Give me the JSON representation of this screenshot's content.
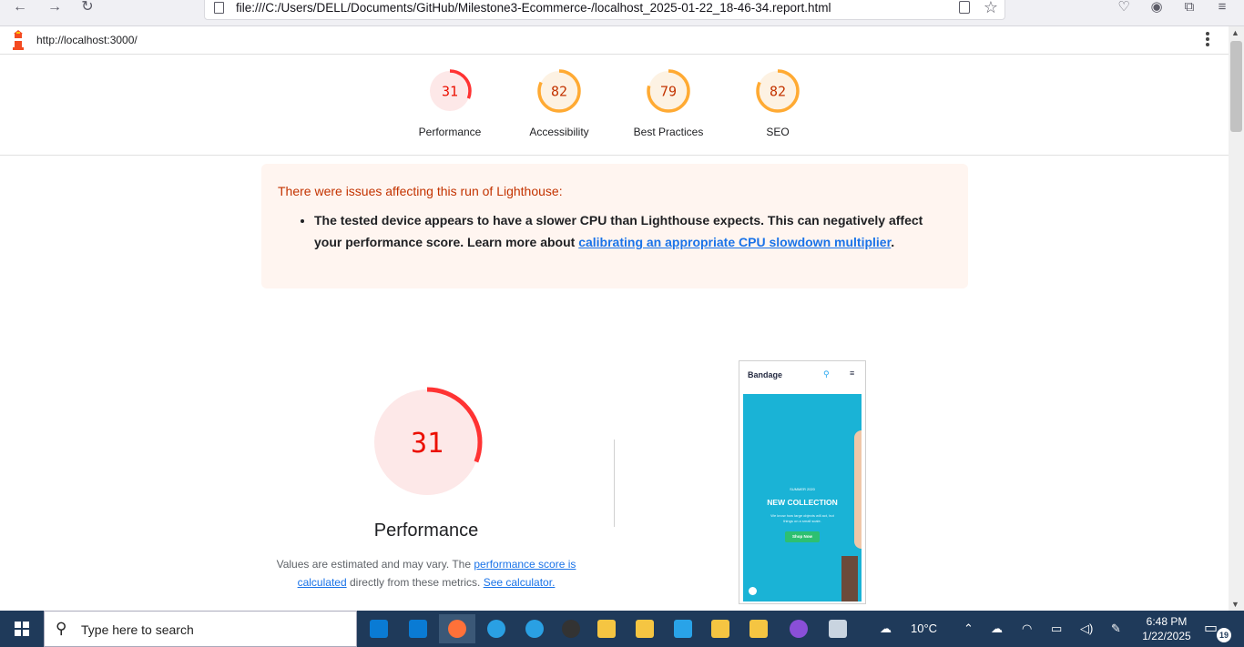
{
  "browser": {
    "url": "file:///C:/Users/DELL/Documents/GitHub/Milestone3-Ecommerce-/localhost_2025-01-22_18-46-34.report.html"
  },
  "lighthouse": {
    "tested_url": "http://localhost:3000/",
    "categories": [
      {
        "score": "31",
        "label": "Performance",
        "value": 31,
        "color": "#ff3333"
      },
      {
        "score": "82",
        "label": "Accessibility",
        "value": 82,
        "color": "#ffaa33"
      },
      {
        "score": "79",
        "label": "Best Practices",
        "value": 79,
        "color": "#ffaa33"
      },
      {
        "score": "82",
        "label": "SEO",
        "value": 82,
        "color": "#ffaa33"
      }
    ],
    "warning": {
      "title": "There were issues affecting this run of Lighthouse:",
      "item_text": "The tested device appears to have a slower CPU than Lighthouse expects. This can negatively affect your performance score. Learn more about ",
      "item_link": "calibrating an appropriate CPU slowdown multiplier",
      "item_end": "."
    },
    "performance": {
      "score": "31",
      "value": 31,
      "title": "Performance",
      "desc_pre": "Values are estimated and may vary. The ",
      "desc_link1": "performance score is calculated",
      "desc_mid": " directly from these metrics. ",
      "desc_link2": "See calculator."
    },
    "screenshot": {
      "brand": "Bandage",
      "season": "SUMMER 2020",
      "title": "NEW COLLECTION",
      "text": "We know how large objects will act, but things on a small scale.",
      "button": "Shop Now"
    }
  },
  "taskbar": {
    "search_placeholder": "Type here to search",
    "weather": "10°C",
    "time": "6:48 PM",
    "date": "1/22/2025",
    "notifications": "19"
  }
}
